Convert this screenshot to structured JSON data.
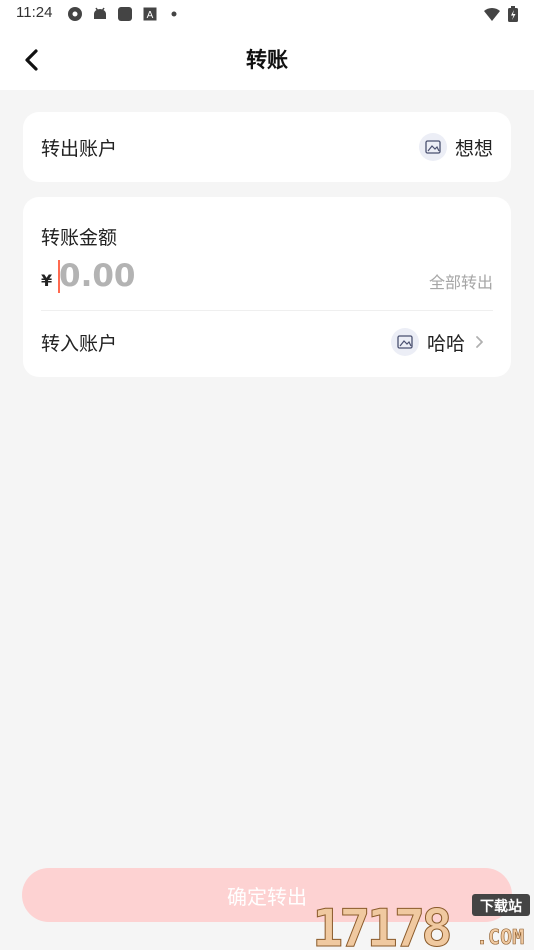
{
  "status_bar": {
    "time": "11:24",
    "icons": [
      "settings-icon",
      "android-icon",
      "app-icon",
      "font-icon",
      "dot-icon",
      "wifi-icon",
      "battery-icon"
    ]
  },
  "header": {
    "title": "转账",
    "back_icon": "chevron-left-icon"
  },
  "from_account": {
    "label": "转出账户",
    "name": "想想",
    "avatar_icon": "avatar-placeholder-icon"
  },
  "transfer": {
    "amount_label": "转账金额",
    "currency_symbol": "¥",
    "amount_value": "",
    "amount_placeholder": "0.00",
    "withdraw_all_label": "全部转出"
  },
  "to_account": {
    "label": "转入账户",
    "name": "哈哈",
    "avatar_icon": "avatar-placeholder-icon",
    "chevron_icon": "chevron-right-icon"
  },
  "confirm_button": {
    "label": "确定转出",
    "enabled": false
  },
  "colors": {
    "background": "#f5f5f5",
    "card": "#ffffff",
    "button_disabled": "#fdd2d2",
    "cursor": "#ff6a50",
    "placeholder": "#b3b3b3"
  },
  "watermark": {
    "text": "17178.COM",
    "caption": "下载站"
  }
}
